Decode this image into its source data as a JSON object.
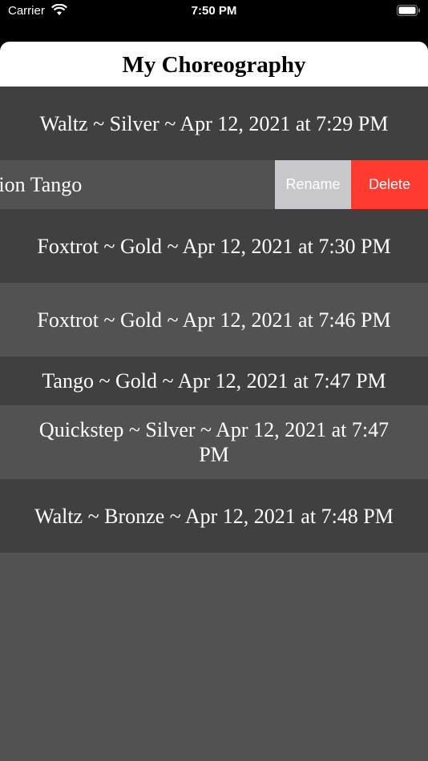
{
  "status_bar": {
    "carrier": "Carrier",
    "time": "7:50 PM"
  },
  "header": {
    "title": "My Choreography"
  },
  "list": {
    "items": [
      {
        "label": "Waltz ~ Silver ~ Apr 12, 2021 at 7:29 PM"
      },
      {
        "label": "mpetition Tango"
      },
      {
        "label": "Foxtrot ~ Gold ~ Apr 12, 2021 at 7:30 PM"
      },
      {
        "label": "Foxtrot ~ Gold ~ Apr 12, 2021 at 7:46 PM"
      },
      {
        "label": "Tango ~ Gold ~ Apr 12, 2021 at 7:47 PM"
      },
      {
        "label": "Quickstep ~ Silver ~ Apr 12, 2021 at 7:47 PM"
      },
      {
        "label": "Waltz ~ Bronze ~ Apr 12, 2021 at 7:48 PM"
      }
    ]
  },
  "swipe_actions": {
    "rename_label": "Rename",
    "delete_label": "Delete"
  },
  "colors": {
    "delete": "#ff3b30",
    "rename": "#c7c7cc",
    "row_dark": "#404040",
    "row_light": "#525252"
  },
  "icons": [
    "wifi-icon",
    "battery-icon"
  ]
}
